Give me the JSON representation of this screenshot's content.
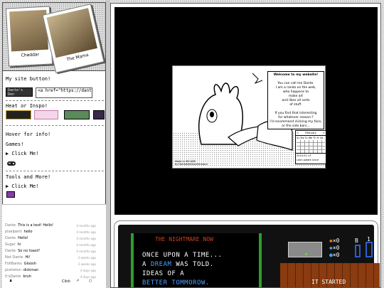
{
  "sidebar": {
    "photos": [
      {
        "caption": "Cheddar"
      },
      {
        "caption": "The Mama"
      }
    ],
    "site_button_heading": "My site button!",
    "site_button_label": "Dante's Den",
    "site_button_code": "<a href=\"https://dante",
    "heat_heading": "Heat or Inspo!",
    "hover_heading": "Hover for info!",
    "games_heading": "Games!",
    "games_click": "▶ Click Me!",
    "tools_heading": "Tools and More!",
    "tools_click": "▶ Click Me!"
  },
  "chat": {
    "messages": [
      {
        "name": "Dante",
        "text": "This is a test! Hello!",
        "time": "4 months ago"
      },
      {
        "name": "pixelperit",
        "text": "hello",
        "time": "4 months ago"
      },
      {
        "name": "Dante",
        "text": "Hello!",
        "time": "4 months ago"
      },
      {
        "name": "Sugar",
        "text": "hi",
        "time": "4 months ago"
      },
      {
        "name": "Dante",
        "text": "So no toast?",
        "time": "4 months ago"
      },
      {
        "name": "Not Dante",
        "text": "Hi!",
        "time": "2 weeks ago"
      },
      {
        "name": "FoliBanks",
        "text": "Gloosh",
        "time": "2 weeks ago"
      },
      {
        "name": "pickleton",
        "text": "dickman",
        "time": "4 days ago"
      },
      {
        "name": "it'sDante",
        "text": "bruh",
        "time": "4 days ago"
      }
    ],
    "bar_label": "Click"
  },
  "scene": {
    "welcome_lines": [
      "Welcome to my website!",
      "",
      "You can call me Dante.",
      "I am a rando on the web,",
      "who happens to",
      "make art",
      "and likes all sorts",
      "of stuff.",
      "",
      "If you find that interesting",
      "for whatever reason-?",
      "I'd recommend clicking my face,",
      "or the side bars..."
    ],
    "calendar_month": "February",
    "calendar_days": "Su Mo Tu We Th Fr Sa",
    "calendar_date": "2024-02-13",
    "last_update": "Last update since",
    "credit_lines": [
      "Made in SECADE",
      "by DantesDemonDinosaur"
    ]
  },
  "game": {
    "title": "THE NIGHTMARE NOW",
    "lines": [
      "ONCE UPON A TIME...",
      "A DREAM WAS TOLD.",
      "IDEAS OF A",
      "BETTER TOMMOROW."
    ],
    "highlight_word": "DREAM",
    "highlight_line4": "BETTER TOMMOROW.",
    "hud_top": "×0",
    "hud_b": "B",
    "hud_one": "1",
    "it_started": "IT STARTED"
  }
}
